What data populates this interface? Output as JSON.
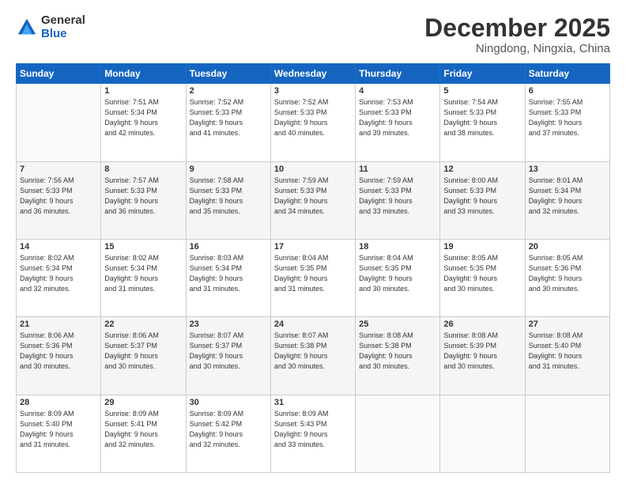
{
  "logo": {
    "general": "General",
    "blue": "Blue"
  },
  "header": {
    "title": "December 2025",
    "subtitle": "Ningdong, Ningxia, China"
  },
  "weekdays": [
    "Sunday",
    "Monday",
    "Tuesday",
    "Wednesday",
    "Thursday",
    "Friday",
    "Saturday"
  ],
  "weeks": [
    [
      {
        "day": "",
        "info": ""
      },
      {
        "day": "1",
        "info": "Sunrise: 7:51 AM\nSunset: 5:34 PM\nDaylight: 9 hours\nand 42 minutes."
      },
      {
        "day": "2",
        "info": "Sunrise: 7:52 AM\nSunset: 5:33 PM\nDaylight: 9 hours\nand 41 minutes."
      },
      {
        "day": "3",
        "info": "Sunrise: 7:52 AM\nSunset: 5:33 PM\nDaylight: 9 hours\nand 40 minutes."
      },
      {
        "day": "4",
        "info": "Sunrise: 7:53 AM\nSunset: 5:33 PM\nDaylight: 9 hours\nand 39 minutes."
      },
      {
        "day": "5",
        "info": "Sunrise: 7:54 AM\nSunset: 5:33 PM\nDaylight: 9 hours\nand 38 minutes."
      },
      {
        "day": "6",
        "info": "Sunrise: 7:55 AM\nSunset: 5:33 PM\nDaylight: 9 hours\nand 37 minutes."
      }
    ],
    [
      {
        "day": "7",
        "info": "Sunrise: 7:56 AM\nSunset: 5:33 PM\nDaylight: 9 hours\nand 36 minutes."
      },
      {
        "day": "8",
        "info": "Sunrise: 7:57 AM\nSunset: 5:33 PM\nDaylight: 9 hours\nand 36 minutes."
      },
      {
        "day": "9",
        "info": "Sunrise: 7:58 AM\nSunset: 5:33 PM\nDaylight: 9 hours\nand 35 minutes."
      },
      {
        "day": "10",
        "info": "Sunrise: 7:59 AM\nSunset: 5:33 PM\nDaylight: 9 hours\nand 34 minutes."
      },
      {
        "day": "11",
        "info": "Sunrise: 7:59 AM\nSunset: 5:33 PM\nDaylight: 9 hours\nand 33 minutes."
      },
      {
        "day": "12",
        "info": "Sunrise: 8:00 AM\nSunset: 5:33 PM\nDaylight: 9 hours\nand 33 minutes."
      },
      {
        "day": "13",
        "info": "Sunrise: 8:01 AM\nSunset: 5:34 PM\nDaylight: 9 hours\nand 32 minutes."
      }
    ],
    [
      {
        "day": "14",
        "info": "Sunrise: 8:02 AM\nSunset: 5:34 PM\nDaylight: 9 hours\nand 32 minutes."
      },
      {
        "day": "15",
        "info": "Sunrise: 8:02 AM\nSunset: 5:34 PM\nDaylight: 9 hours\nand 31 minutes."
      },
      {
        "day": "16",
        "info": "Sunrise: 8:03 AM\nSunset: 5:34 PM\nDaylight: 9 hours\nand 31 minutes."
      },
      {
        "day": "17",
        "info": "Sunrise: 8:04 AM\nSunset: 5:35 PM\nDaylight: 9 hours\nand 31 minutes."
      },
      {
        "day": "18",
        "info": "Sunrise: 8:04 AM\nSunset: 5:35 PM\nDaylight: 9 hours\nand 30 minutes."
      },
      {
        "day": "19",
        "info": "Sunrise: 8:05 AM\nSunset: 5:35 PM\nDaylight: 9 hours\nand 30 minutes."
      },
      {
        "day": "20",
        "info": "Sunrise: 8:05 AM\nSunset: 5:36 PM\nDaylight: 9 hours\nand 30 minutes."
      }
    ],
    [
      {
        "day": "21",
        "info": "Sunrise: 8:06 AM\nSunset: 5:36 PM\nDaylight: 9 hours\nand 30 minutes."
      },
      {
        "day": "22",
        "info": "Sunrise: 8:06 AM\nSunset: 5:37 PM\nDaylight: 9 hours\nand 30 minutes."
      },
      {
        "day": "23",
        "info": "Sunrise: 8:07 AM\nSunset: 5:37 PM\nDaylight: 9 hours\nand 30 minutes."
      },
      {
        "day": "24",
        "info": "Sunrise: 8:07 AM\nSunset: 5:38 PM\nDaylight: 9 hours\nand 30 minutes."
      },
      {
        "day": "25",
        "info": "Sunrise: 8:08 AM\nSunset: 5:38 PM\nDaylight: 9 hours\nand 30 minutes."
      },
      {
        "day": "26",
        "info": "Sunrise: 8:08 AM\nSunset: 5:39 PM\nDaylight: 9 hours\nand 30 minutes."
      },
      {
        "day": "27",
        "info": "Sunrise: 8:08 AM\nSunset: 5:40 PM\nDaylight: 9 hours\nand 31 minutes."
      }
    ],
    [
      {
        "day": "28",
        "info": "Sunrise: 8:09 AM\nSunset: 5:40 PM\nDaylight: 9 hours\nand 31 minutes."
      },
      {
        "day": "29",
        "info": "Sunrise: 8:09 AM\nSunset: 5:41 PM\nDaylight: 9 hours\nand 32 minutes."
      },
      {
        "day": "30",
        "info": "Sunrise: 8:09 AM\nSunset: 5:42 PM\nDaylight: 9 hours\nand 32 minutes."
      },
      {
        "day": "31",
        "info": "Sunrise: 8:09 AM\nSunset: 5:43 PM\nDaylight: 9 hours\nand 33 minutes."
      },
      {
        "day": "",
        "info": ""
      },
      {
        "day": "",
        "info": ""
      },
      {
        "day": "",
        "info": ""
      }
    ]
  ]
}
